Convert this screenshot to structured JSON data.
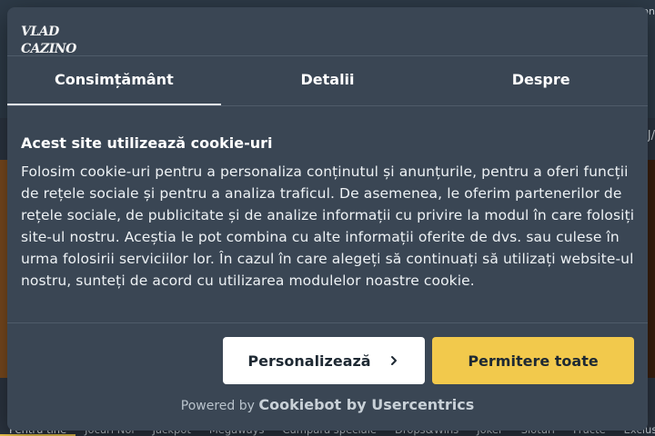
{
  "background": {
    "top_right_text": "on",
    "right_tag": "J/",
    "nav": [
      "Pentru tine",
      "Jocuri Noi",
      "Jackpot",
      "Megaways",
      "Cumpara speciale",
      "Drops&Wins",
      "Joker",
      "Sloturi",
      "Fructe",
      "Exclusive"
    ]
  },
  "dialog": {
    "logo_text": "VLAD CAZINO",
    "tabs": [
      "Consimțământ",
      "Detalii",
      "Despre"
    ],
    "heading": "Acest site utilizează cookie-uri",
    "body": "Folosim cookie-uri pentru a personaliza conținutul și anunțurile, pentru a oferi funcții de rețele sociale și pentru a analiza traficul. De asemenea, le oferim partenerilor de rețele sociale, de publicitate și de analize informații cu privire la modul în care folosiți site-ul nostru. Aceștia le pot combina cu alte informații oferite de dvs. sau culese în urma folosirii serviciilor lor. În cazul în care alegeți să continuați să utilizați website-ul nostru, sunteți de acord cu utilizarea modulelor noastre cookie.",
    "customize_label": "Personalizează",
    "allow_all_label": "Permitere toate",
    "powered_prefix": "Powered by",
    "powered_brand": "Cookiebot by Usercentrics"
  },
  "colors": {
    "dialog_bg": "#3a4654",
    "accent": "#f2c94c",
    "page_bg": "#2b3440"
  }
}
